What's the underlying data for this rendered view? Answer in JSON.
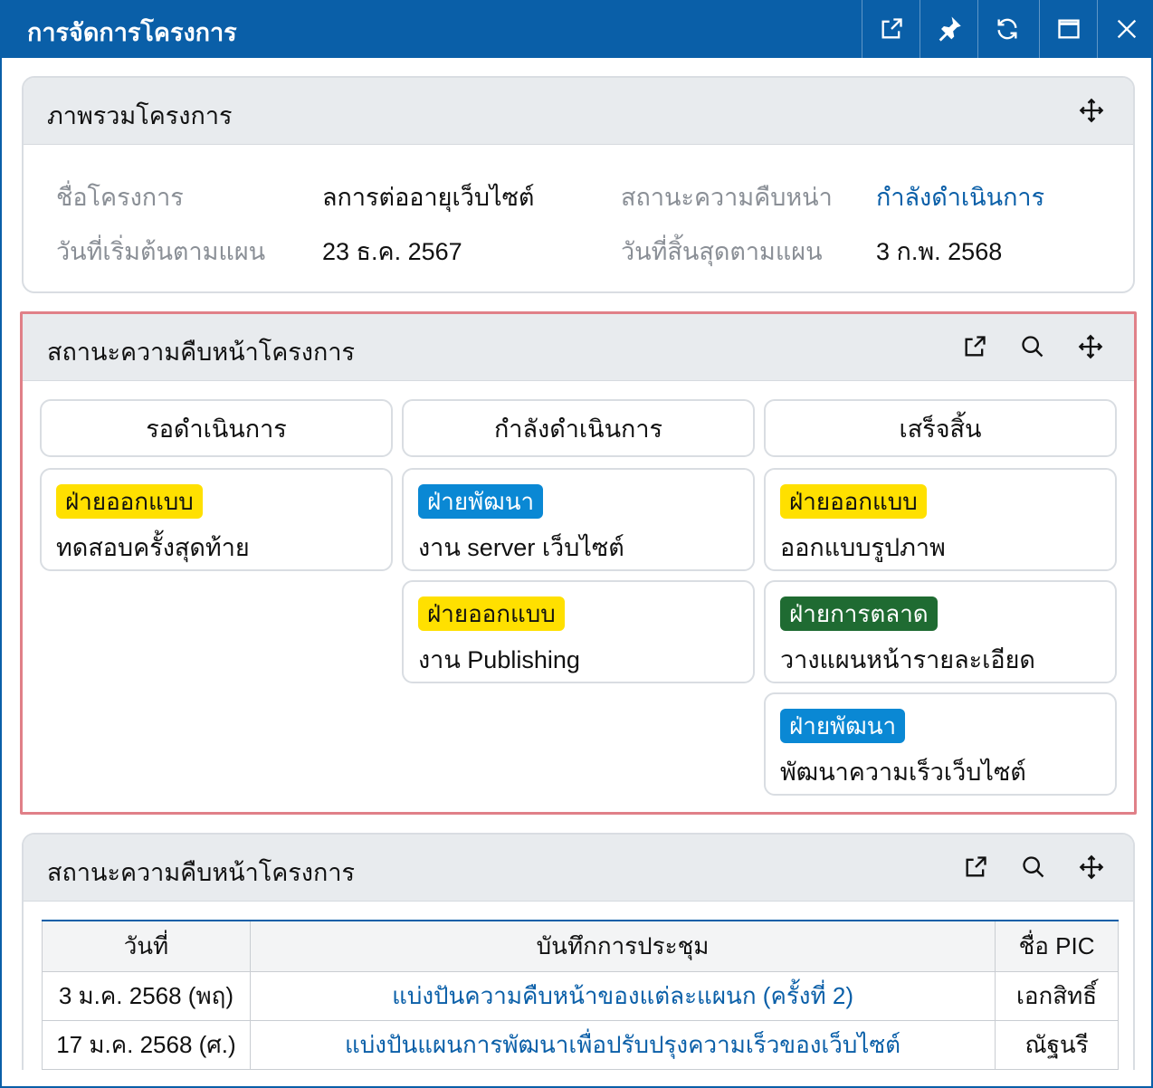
{
  "window": {
    "title": "การจัดการโครงการ",
    "accent": "#0a5fa8",
    "controls": [
      "external-link-icon",
      "pin-icon",
      "refresh-icon",
      "maximize-icon",
      "close-icon"
    ]
  },
  "overview": {
    "title": "ภาพรวมโครงการ",
    "fields": [
      {
        "label": "ชื่อโครงการ",
        "value": "ลการต่ออายุเว็บไซต์"
      },
      {
        "label": "สถานะความคืบหน่า",
        "value": "กำลังดำเนินการ"
      },
      {
        "label": "วันที่เริ่มต้นตามแผน",
        "value": "23 ธ.ค. 2567"
      },
      {
        "label": "วันที่สิ้นสุดตามแผน",
        "value": "3 ก.พ. 2568"
      }
    ]
  },
  "kanban": {
    "title": "สถานะความคืบหน้าโครงการ",
    "columns": [
      {
        "name": "รอดำเนินการ",
        "cards": [
          {
            "tag": "ฝ่ายออกแบบ",
            "text": "ทดสอบครั้งสุดท้าย"
          }
        ]
      },
      {
        "name": "กำลังดำเนินการ",
        "cards": [
          {
            "tag": "ฝ่ายพัฒนา",
            "text": "งาน server เว็บไซต์"
          },
          {
            "tag": "ฝ่ายออกแบบ",
            "text": "งาน Publishing"
          }
        ]
      },
      {
        "name": "เสร็จสิ้น",
        "cards": [
          {
            "tag": "ฝ่ายออกแบบ",
            "text": "ออกแบบรูปภาพ"
          },
          {
            "tag": "ฝ่ายการตลาด",
            "text": "วางแผนหน้ารายละเอียด"
          },
          {
            "tag": "ฝ่ายพัฒนา",
            "text": "พัฒนาความเร็วเว็บไซต์"
          }
        ]
      }
    ],
    "tag_colors": {
      "design": "#ffe000",
      "dev": "#0a88d4",
      "marketing": "#1f6b32"
    }
  },
  "meetings": {
    "title": "สถานะความคืบหน้าโครงการ",
    "headers": [
      "วันที่",
      "บันทึกการประชุม",
      "ชื่อ PIC"
    ],
    "rows": [
      {
        "date": "3 ม.ค. 2568 (พฤ)",
        "note": "แบ่งปันความคืบหน้าของแต่ละแผนก (ครั้งที่ 2)",
        "pic": "เอกสิทธิ์"
      },
      {
        "date": "17 ม.ค. 2568 (ศ.)",
        "note": "แบ่งปันแผนการพัฒนาเพื่อปรับปรุงความเร็วของเว็บไซต์",
        "pic": "ณัฐนรี"
      }
    ]
  }
}
